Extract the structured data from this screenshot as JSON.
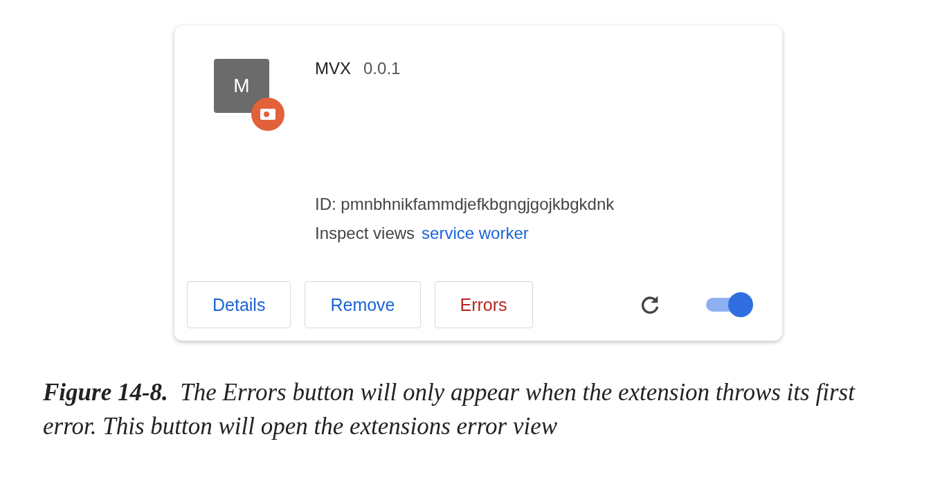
{
  "extension_card": {
    "icon_letter": "M",
    "name": "MVX",
    "version": "0.0.1",
    "id_line": "ID: pmnbhnikfammdjefkbgngjgojkbgkdnk",
    "inspect_label": "Inspect views",
    "inspect_link": "service worker",
    "buttons": [
      {
        "label": "Details",
        "kind": "normal"
      },
      {
        "label": "Remove",
        "kind": "normal"
      },
      {
        "label": "Errors",
        "kind": "error"
      }
    ],
    "enabled": true
  },
  "caption": "**Figure 14-8.**  The Errors button will only appear when the extension throws its first error. This button will open the extensions error view"
}
